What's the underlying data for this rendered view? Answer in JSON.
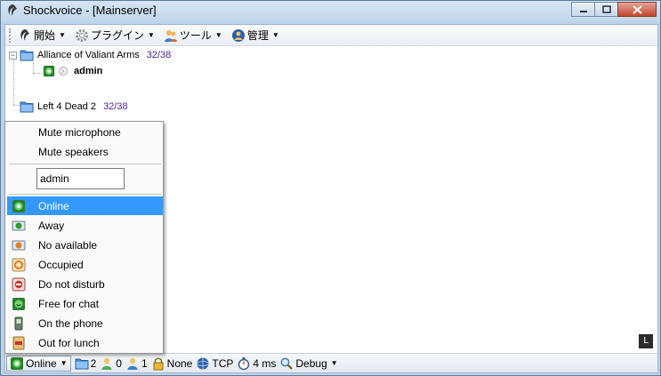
{
  "window": {
    "title": "Shockvoice - [Mainserver]"
  },
  "toolbar": {
    "items": [
      {
        "label": "開始",
        "icon": "shockvoice-logo-icon"
      },
      {
        "label": "プラグイン",
        "icon": "gear-icon"
      },
      {
        "label": "ツール",
        "icon": "users-icon"
      },
      {
        "label": "管理",
        "icon": "admin-icon"
      }
    ]
  },
  "tree": {
    "channels": [
      {
        "name": "Alliance of Valiant Arms",
        "count": "32/38",
        "expanded": true,
        "users": [
          {
            "name": "admin",
            "status_icon": "online-icon"
          }
        ]
      },
      {
        "name": "Left 4 Dead 2",
        "count": "32/38",
        "expanded": false,
        "users": []
      }
    ]
  },
  "menu": {
    "mute_microphone": "Mute microphone",
    "mute_speakers": "Mute speakers",
    "nickname_value": "admin",
    "statuses": [
      {
        "label": "Online",
        "icon": "online-icon",
        "selected": true
      },
      {
        "label": "Away",
        "icon": "away-icon",
        "selected": false
      },
      {
        "label": "No available",
        "icon": "not-available-icon",
        "selected": false
      },
      {
        "label": "Occupied",
        "icon": "occupied-icon",
        "selected": false
      },
      {
        "label": "Do not disturb",
        "icon": "do-not-disturb-icon",
        "selected": false
      },
      {
        "label": "Free for chat",
        "icon": "free-for-chat-icon",
        "selected": false
      },
      {
        "label": "On the phone",
        "icon": "phone-icon",
        "selected": false
      },
      {
        "label": "Out for lunch",
        "icon": "lunch-icon",
        "selected": false
      }
    ]
  },
  "corner_badge": "L",
  "statusbar": {
    "status": "Online",
    "channels": "2",
    "users": "0",
    "admins": "1",
    "encryption": "None",
    "protocol": "TCP",
    "ping": "4 ms",
    "debug": "Debug"
  },
  "colors": {
    "selection": "#3399ff",
    "count_text": "#4b1f8f",
    "title_bar": "#c2d7ec"
  }
}
